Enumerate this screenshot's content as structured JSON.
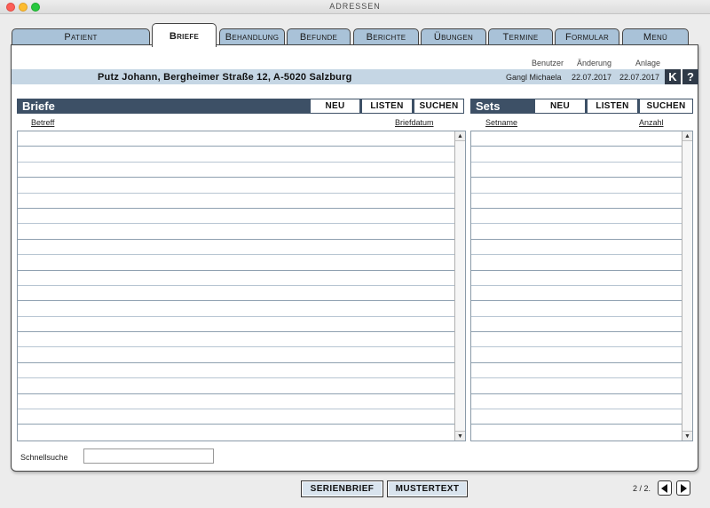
{
  "window": {
    "title": "ADRESSEN"
  },
  "tabs": [
    {
      "label": "Patient",
      "active": false
    },
    {
      "label": "Briefe",
      "active": true
    },
    {
      "label": "Behandlung",
      "active": false
    },
    {
      "label": "Befunde",
      "active": false
    },
    {
      "label": "Berichte",
      "active": false
    },
    {
      "label": "Übungen",
      "active": false
    },
    {
      "label": "Termine",
      "active": false
    },
    {
      "label": "Formular",
      "active": false
    },
    {
      "label": "Menü",
      "active": false
    }
  ],
  "header": {
    "patient": "Putz Johann, Bergheimer Straße 12, A-5020 Salzburg",
    "user_label": "Benutzer",
    "user_value": "Gangl Michaela",
    "changed_label": "Änderung",
    "changed_value": "22.07.2017",
    "created_label": "Anlage",
    "created_value": "22.07.2017",
    "k_button": "K",
    "help_button": "?"
  },
  "briefe": {
    "title": "Briefe",
    "new_label": "NEU",
    "list_label": "LISTEN",
    "search_label": "SUCHEN",
    "col_subject": "Betreff",
    "col_date": "Briefdatum"
  },
  "sets": {
    "title": "Sets",
    "new_label": "NEU",
    "list_label": "LISTEN",
    "search_label": "SUCHEN",
    "col_name": "Setname",
    "col_count": "Anzahl"
  },
  "quick_search": {
    "label": "Schnellsuche",
    "value": ""
  },
  "footer": {
    "serial_letter": "SERIENBRIEF",
    "template_text": "MUSTERTEXT",
    "page": "2 / 2."
  }
}
